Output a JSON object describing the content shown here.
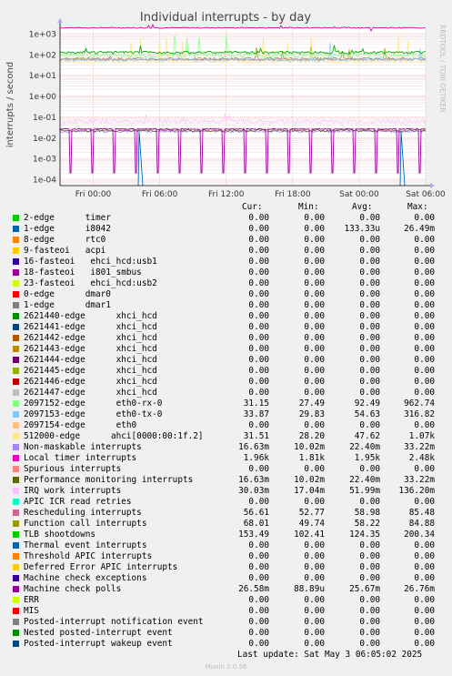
{
  "title": "Individual interrupts - by day",
  "side_label": "RRDTOOL / TOBI OETIKER",
  "chart_data": {
    "type": "line",
    "title": "Individual interrupts - by day",
    "ylabel": "interrupts / second",
    "yscale": "log",
    "ylim": [
      5e-05,
      2000
    ],
    "y_ticks": [
      "1e+03",
      "1e+02",
      "1e+01",
      "1e+00",
      "1e-01",
      "1e-02",
      "1e-03",
      "1e-04"
    ],
    "x_ticks": [
      "Fri 00:00",
      "Fri 06:00",
      "Fri 12:00",
      "Fri 18:00",
      "Sat 00:00",
      "Sat 06:00"
    ],
    "x_range_hours": [
      -3,
      30
    ],
    "grid": true,
    "series": [
      {
        "name": "Function call interrupts",
        "color": "#ffcc00",
        "values": [
          58,
          60,
          55,
          62,
          57,
          59
        ]
      },
      {
        "name": "TLB shootdowns",
        "color": "#00cc00",
        "values": [
          124,
          130,
          118,
          135,
          120,
          128
        ]
      },
      {
        "name": "Rescheduling interrupts",
        "color": "#cc7777",
        "values": [
          58,
          60,
          57,
          59,
          58,
          60
        ]
      },
      {
        "name": "IRQ work interrupts",
        "color": "#ffaaff",
        "values": [
          0.052,
          0.06,
          0.045,
          0.05,
          0.055,
          0.05
        ]
      },
      {
        "name": "Performance monitoring interrupts",
        "color": "#556600",
        "values": [
          0.022,
          0.022,
          0.022,
          0.022,
          0.022,
          0.022
        ]
      },
      {
        "name": "Machine check polls",
        "color": "#990099",
        "values": [
          0.026,
          0.026,
          0.026,
          0.026,
          0.026,
          0.026
        ]
      }
    ]
  },
  "legend": {
    "headers": {
      "cur": "Cur:",
      "min": "Min:",
      "avg": "Avg:",
      "max": "Max:"
    },
    "rows": [
      {
        "name": "2-edge      timer",
        "color": "#00cc00",
        "cur": "0.00",
        "min": "0.00",
        "avg": "0.00",
        "max": "0.00"
      },
      {
        "name": "1-edge      i8042",
        "color": "#0066b3",
        "cur": "0.00",
        "min": "0.00",
        "avg": "133.33u",
        "max": "26.49m"
      },
      {
        "name": "8-edge      rtc0",
        "color": "#ff8000",
        "cur": "0.00",
        "min": "0.00",
        "avg": "0.00",
        "max": "0.00"
      },
      {
        "name": "9-fasteoi   acpi",
        "color": "#ffcc00",
        "cur": "0.00",
        "min": "0.00",
        "avg": "0.00",
        "max": "0.00"
      },
      {
        "name": "16-fasteoi   ehci_hcd:usb1",
        "color": "#330099",
        "cur": "0.00",
        "min": "0.00",
        "avg": "0.00",
        "max": "0.00"
      },
      {
        "name": "18-fasteoi   i801_smbus",
        "color": "#990099",
        "cur": "0.00",
        "min": "0.00",
        "avg": "0.00",
        "max": "0.00"
      },
      {
        "name": "23-fasteoi   ehci_hcd:usb2",
        "color": "#ccff00",
        "cur": "0.00",
        "min": "0.00",
        "avg": "0.00",
        "max": "0.00"
      },
      {
        "name": "0-edge      dmar0",
        "color": "#ff0000",
        "cur": "0.00",
        "min": "0.00",
        "avg": "0.00",
        "max": "0.00"
      },
      {
        "name": "1-edge      dmar1",
        "color": "#808080",
        "cur": "0.00",
        "min": "0.00",
        "avg": "0.00",
        "max": "0.00"
      },
      {
        "name": "2621440-edge      xhci_hcd",
        "color": "#008f00",
        "cur": "0.00",
        "min": "0.00",
        "avg": "0.00",
        "max": "0.00"
      },
      {
        "name": "2621441-edge      xhci_hcd",
        "color": "#00487d",
        "cur": "0.00",
        "min": "0.00",
        "avg": "0.00",
        "max": "0.00"
      },
      {
        "name": "2621442-edge      xhci_hcd",
        "color": "#b35a00",
        "cur": "0.00",
        "min": "0.00",
        "avg": "0.00",
        "max": "0.00"
      },
      {
        "name": "2621443-edge      xhci_hcd",
        "color": "#b38f00",
        "cur": "0.00",
        "min": "0.00",
        "avg": "0.00",
        "max": "0.00"
      },
      {
        "name": "2621444-edge      xhci_hcd",
        "color": "#6b006b",
        "cur": "0.00",
        "min": "0.00",
        "avg": "0.00",
        "max": "0.00"
      },
      {
        "name": "2621445-edge      xhci_hcd",
        "color": "#8fb300",
        "cur": "0.00",
        "min": "0.00",
        "avg": "0.00",
        "max": "0.00"
      },
      {
        "name": "2621446-edge      xhci_hcd",
        "color": "#b30000",
        "cur": "0.00",
        "min": "0.00",
        "avg": "0.00",
        "max": "0.00"
      },
      {
        "name": "2621447-edge      xhci_hcd",
        "color": "#bebebe",
        "cur": "0.00",
        "min": "0.00",
        "avg": "0.00",
        "max": "0.00"
      },
      {
        "name": "2097152-edge      eth0-rx-0",
        "color": "#80ff80",
        "cur": "31.15",
        "min": "27.49",
        "avg": "92.49",
        "max": "962.74"
      },
      {
        "name": "2097153-edge      eth0-tx-0",
        "color": "#80c9ff",
        "cur": "33.87",
        "min": "29.83",
        "avg": "54.63",
        "max": "316.82"
      },
      {
        "name": "2097154-edge      eth0",
        "color": "#ffc080",
        "cur": "0.00",
        "min": "0.00",
        "avg": "0.00",
        "max": "0.00"
      },
      {
        "name": "512000-edge      ahci[0000:00:1f.2]",
        "color": "#ffe680",
        "cur": "31.51",
        "min": "28.20",
        "avg": "47.62",
        "max": "1.07k"
      },
      {
        "name": "Non-maskable interrupts",
        "color": "#aa80ff",
        "cur": "16.63m",
        "min": "10.02m",
        "avg": "22.40m",
        "max": "33.22m"
      },
      {
        "name": "Local timer interrupts",
        "color": "#ee00cc",
        "cur": "1.96k",
        "min": "1.81k",
        "avg": "1.95k",
        "max": "2.48k"
      },
      {
        "name": "Spurious interrupts",
        "color": "#ff8080",
        "cur": "0.00",
        "min": "0.00",
        "avg": "0.00",
        "max": "0.00"
      },
      {
        "name": "Performance monitoring interrupts",
        "color": "#666600",
        "cur": "16.63m",
        "min": "10.02m",
        "avg": "22.40m",
        "max": "33.22m"
      },
      {
        "name": "IRQ work interrupts",
        "color": "#ffbfff",
        "cur": "30.03m",
        "min": "17.04m",
        "avg": "51.99m",
        "max": "136.20m"
      },
      {
        "name": "APIC ICR read retries",
        "color": "#00ffcc",
        "cur": "0.00",
        "min": "0.00",
        "avg": "0.00",
        "max": "0.00"
      },
      {
        "name": "Rescheduling interrupts",
        "color": "#cc6699",
        "cur": "56.61",
        "min": "52.77",
        "avg": "58.98",
        "max": "85.48"
      },
      {
        "name": "Function call interrupts",
        "color": "#999900",
        "cur": "68.01",
        "min": "49.74",
        "avg": "58.22",
        "max": "84.88"
      },
      {
        "name": "TLB shootdowns",
        "color": "#00cc00",
        "cur": "153.49",
        "min": "102.41",
        "avg": "124.35",
        "max": "200.34"
      },
      {
        "name": "Thermal event interrupts",
        "color": "#0066b3",
        "cur": "0.00",
        "min": "0.00",
        "avg": "0.00",
        "max": "0.00"
      },
      {
        "name": "Threshold APIC interrupts",
        "color": "#ff8000",
        "cur": "0.00",
        "min": "0.00",
        "avg": "0.00",
        "max": "0.00"
      },
      {
        "name": "Deferred Error APIC interrupts",
        "color": "#ffcc00",
        "cur": "0.00",
        "min": "0.00",
        "avg": "0.00",
        "max": "0.00"
      },
      {
        "name": "Machine check exceptions",
        "color": "#330099",
        "cur": "0.00",
        "min": "0.00",
        "avg": "0.00",
        "max": "0.00"
      },
      {
        "name": "Machine check polls",
        "color": "#990099",
        "cur": "26.58m",
        "min": "88.89u",
        "avg": "25.67m",
        "max": "26.76m"
      },
      {
        "name": "ERR",
        "color": "#ccff00",
        "cur": "0.00",
        "min": "0.00",
        "avg": "0.00",
        "max": "0.00"
      },
      {
        "name": "MIS",
        "color": "#ff0000",
        "cur": "0.00",
        "min": "0.00",
        "avg": "0.00",
        "max": "0.00"
      },
      {
        "name": "Posted-interrupt notification event",
        "color": "#808080",
        "cur": "0.00",
        "min": "0.00",
        "avg": "0.00",
        "max": "0.00"
      },
      {
        "name": "Nested posted-interrupt event",
        "color": "#008f00",
        "cur": "0.00",
        "min": "0.00",
        "avg": "0.00",
        "max": "0.00"
      },
      {
        "name": "Posted-interrupt wakeup event",
        "color": "#00487d",
        "cur": "0.00",
        "min": "0.00",
        "avg": "0.00",
        "max": "0.00"
      }
    ]
  },
  "last_update": "Last update: Sat May  3 06:05:02 2025",
  "munin_version": "Munin 2.0.56"
}
